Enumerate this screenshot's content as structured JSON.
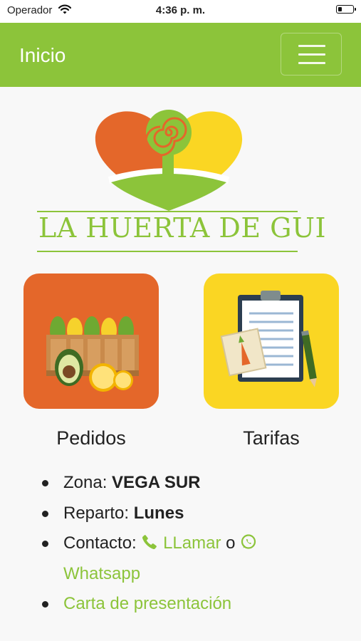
{
  "status_bar": {
    "carrier": "Operador",
    "time": "4:36 p. m."
  },
  "navbar": {
    "title": "Inicio"
  },
  "brand": {
    "name": "LA HUERTA DE GUI"
  },
  "tiles": [
    {
      "label": "Pedidos",
      "icon": "crate-of-vegetables-icon"
    },
    {
      "label": "Tarifas",
      "icon": "clipboard-price-list-icon"
    }
  ],
  "info": {
    "zona_label": "Zona:",
    "zona_value": "VEGA SUR",
    "reparto_label": "Reparto:",
    "reparto_value": "Lunes",
    "contacto_label": "Contacto:",
    "call_link": "LLamar",
    "separator": "o",
    "whatsapp_link": "Whatsapp",
    "carta_link": "Carta de presentación"
  },
  "colors": {
    "accent": "#8cc43a",
    "orange": "#e4672a",
    "yellow": "#fad623"
  }
}
